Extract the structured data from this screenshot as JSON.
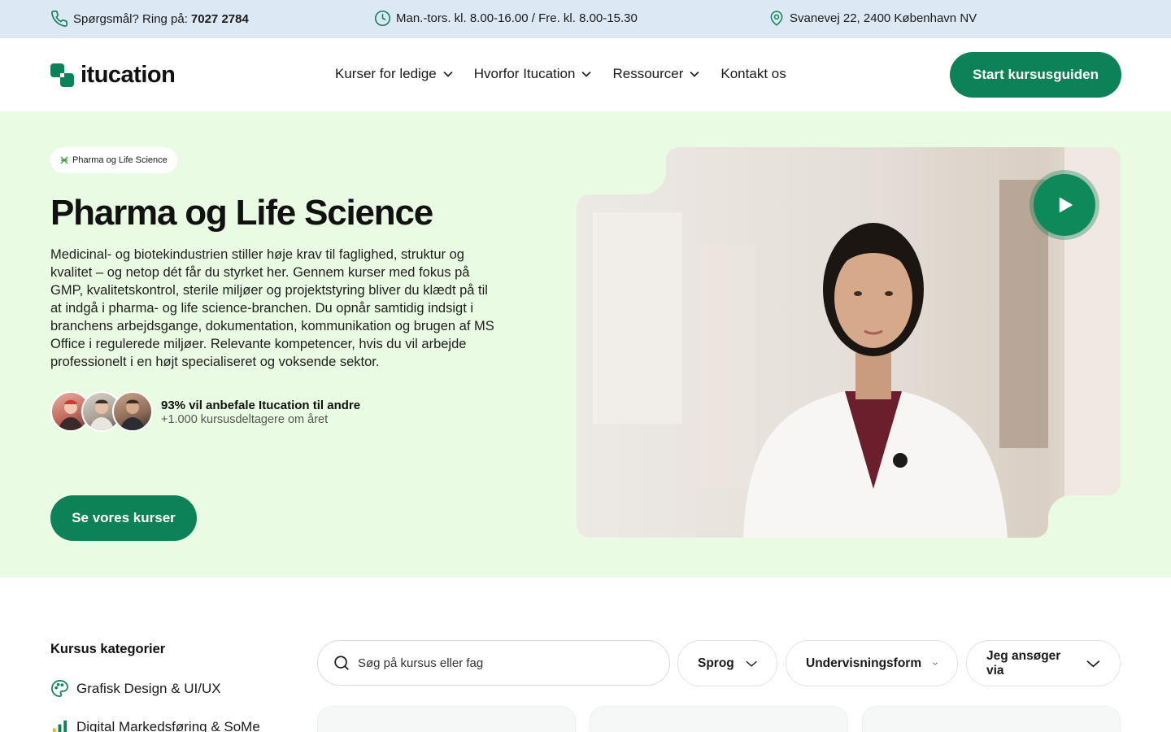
{
  "topbar": {
    "phone_label": "Spørgsmål? Ring på:",
    "phone_number": "7027 2784",
    "hours": "Man.-tors. kl. 8.00-16.00 / Fre. kl. 8.00-15.30",
    "address": "Svanevej 22, 2400 København NV"
  },
  "header": {
    "logo_text": "itucation",
    "nav": [
      {
        "label": "Kurser for ledige",
        "has_dropdown": true
      },
      {
        "label": "Hvorfor Itucation",
        "has_dropdown": true
      },
      {
        "label": "Ressourcer",
        "has_dropdown": true
      },
      {
        "label": "Kontakt os",
        "has_dropdown": false
      }
    ],
    "cta_label": "Start kursusguiden"
  },
  "hero": {
    "badge": "Pharma og Life Science",
    "title": "Pharma og Life Science",
    "description": "Medicinal- og biotekindustrien stiller høje krav til faglighed, struktur og kvalitet – og netop dét får du styrket her. Gennem kurser med fokus på GMP, kvalitetskontrol, sterile miljøer og projektstyring bliver du klædt på til at indgå i pharma- og life science-branchen. Du opnår samtidig indsigt i branchens arbejdsgange, dokumentation, kommunikation og brugen af MS Office i regulerede miljøer. Relevante kompetencer, hvis du vil arbejde professionelt i en højt specialiseret og voksende sektor.",
    "rating_title": "93% vil anbefale Itucation til andre",
    "rating_sub": "+1.000 kursusdeltagere om året",
    "button_label": "Se vores kurser"
  },
  "categories": {
    "title": "Kursus kategorier",
    "items": [
      {
        "label": "Grafisk Design & UI/UX",
        "icon": "palette-icon"
      },
      {
        "label": "Digital Markedsføring & SoMe",
        "icon": "bar-chart-icon"
      }
    ]
  },
  "filters": {
    "search_placeholder": "Søg på kursus eller fag",
    "dropdowns": [
      "Sprog",
      "Undervisningsform",
      "Jeg ansøger via"
    ]
  },
  "colors": {
    "brand_green": "#0d8157",
    "hero_bg": "#e9fbe2",
    "topbar_bg": "#dce8f3"
  }
}
